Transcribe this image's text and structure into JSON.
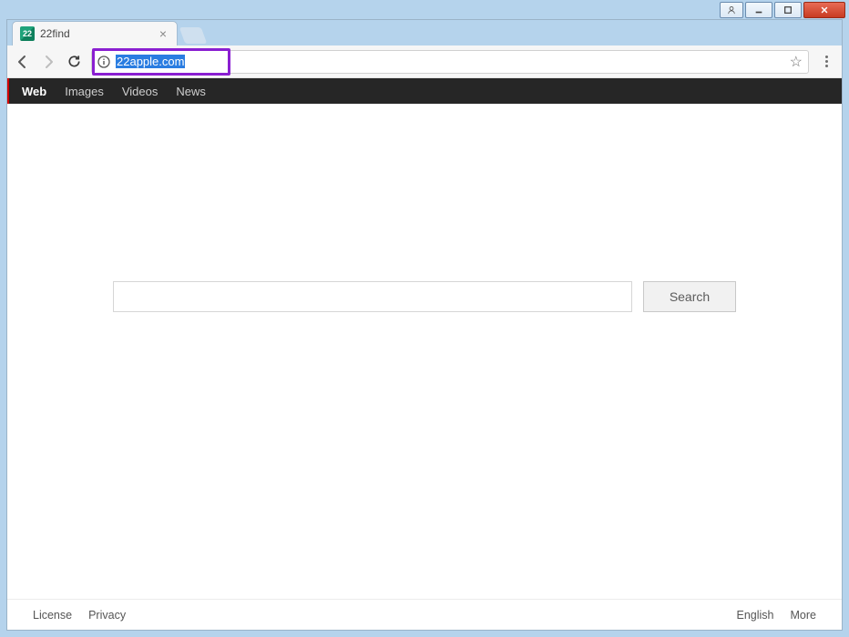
{
  "window": {
    "user_icon": "user",
    "minimize": "min",
    "maximize": "max",
    "close": "X"
  },
  "tab": {
    "favicon_text": "22",
    "title": "22find"
  },
  "addressbar": {
    "url": "22apple.com"
  },
  "nav": {
    "items": [
      {
        "label": "Web",
        "active": true
      },
      {
        "label": "Images",
        "active": false
      },
      {
        "label": "Videos",
        "active": false
      },
      {
        "label": "News",
        "active": false
      }
    ]
  },
  "search": {
    "value": "",
    "placeholder": "",
    "button_label": "Search"
  },
  "footer": {
    "left": [
      {
        "label": "License"
      },
      {
        "label": "Privacy"
      }
    ],
    "right": [
      {
        "label": "English"
      },
      {
        "label": "More"
      }
    ]
  }
}
